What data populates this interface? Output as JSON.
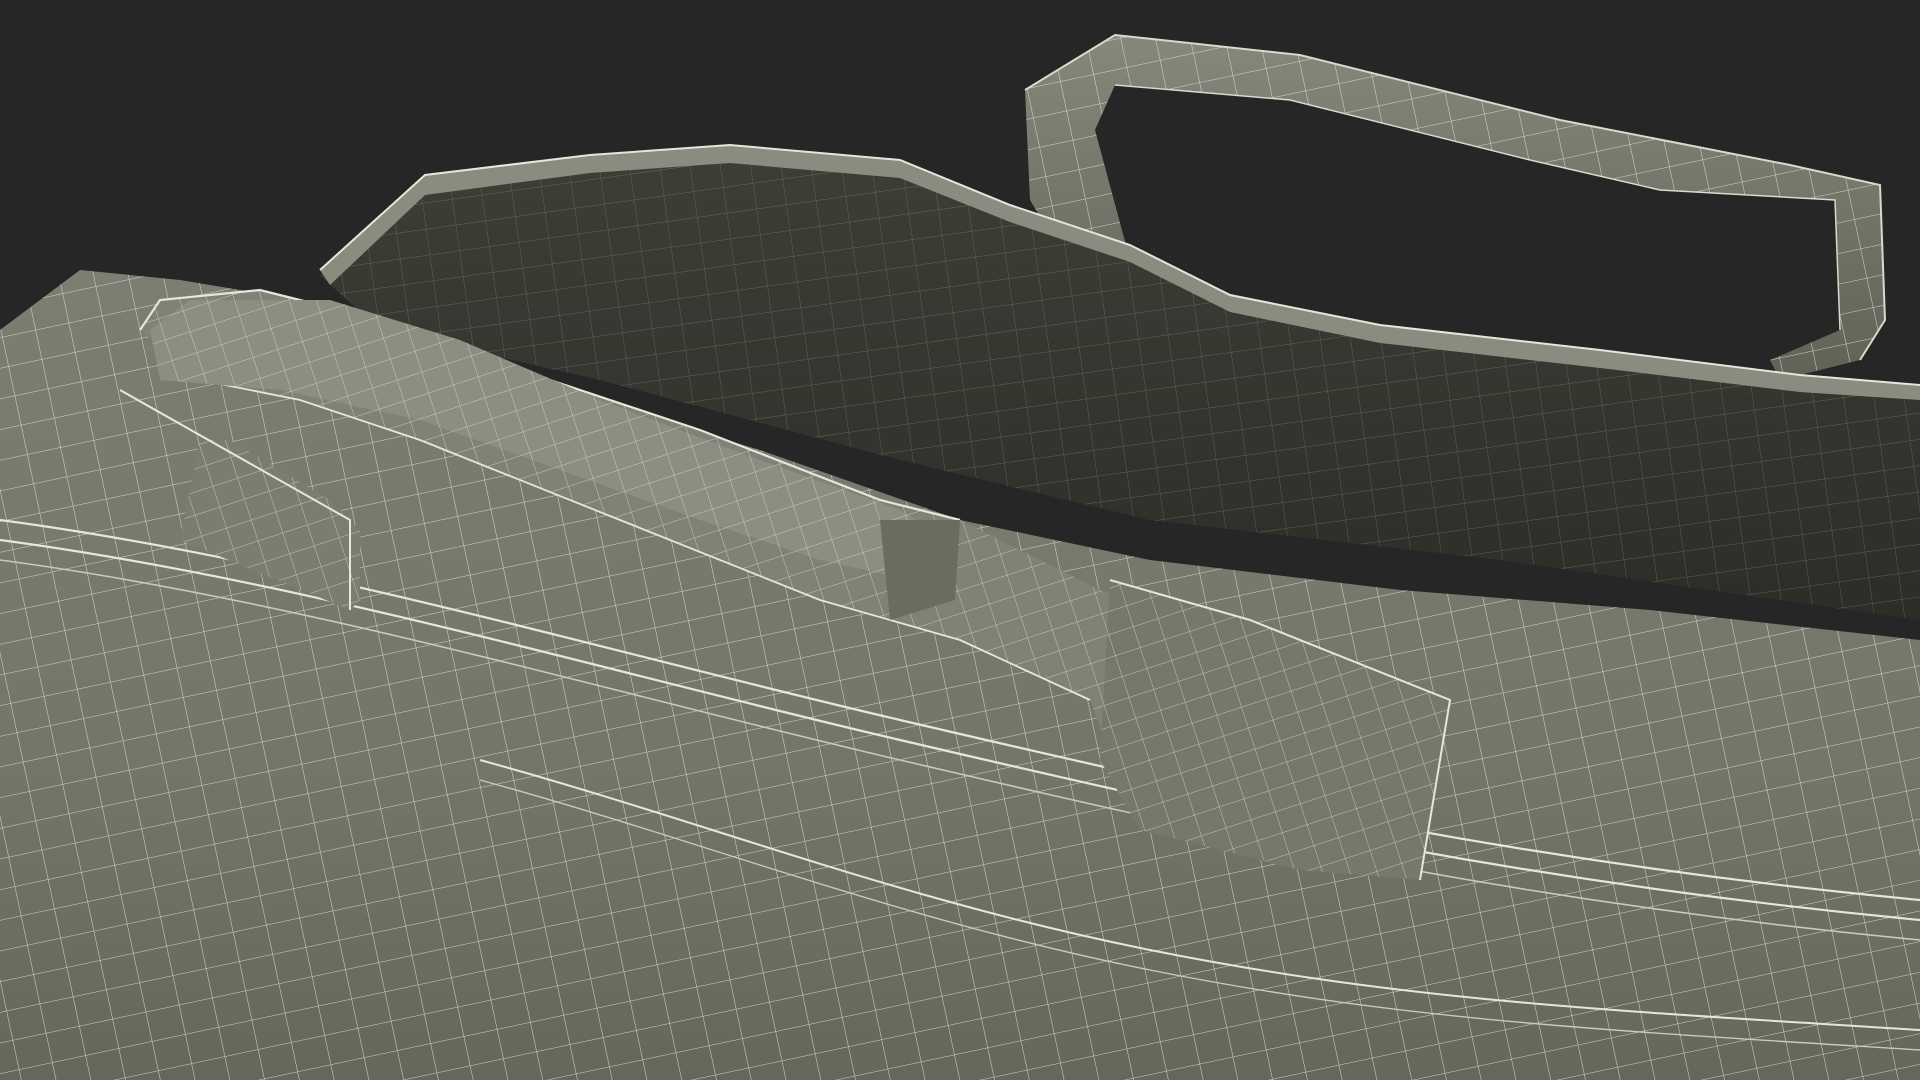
{
  "scene": {
    "subject": "bag-wireframe-render",
    "colors": {
      "background": "#262626",
      "surface_light": "#7f8174",
      "surface_mid": "#6e7064",
      "surface_dark": "#55574c",
      "interior": "#3a3c34",
      "interior_deep": "#2c2e27",
      "wire": "#e6e6dc"
    }
  }
}
